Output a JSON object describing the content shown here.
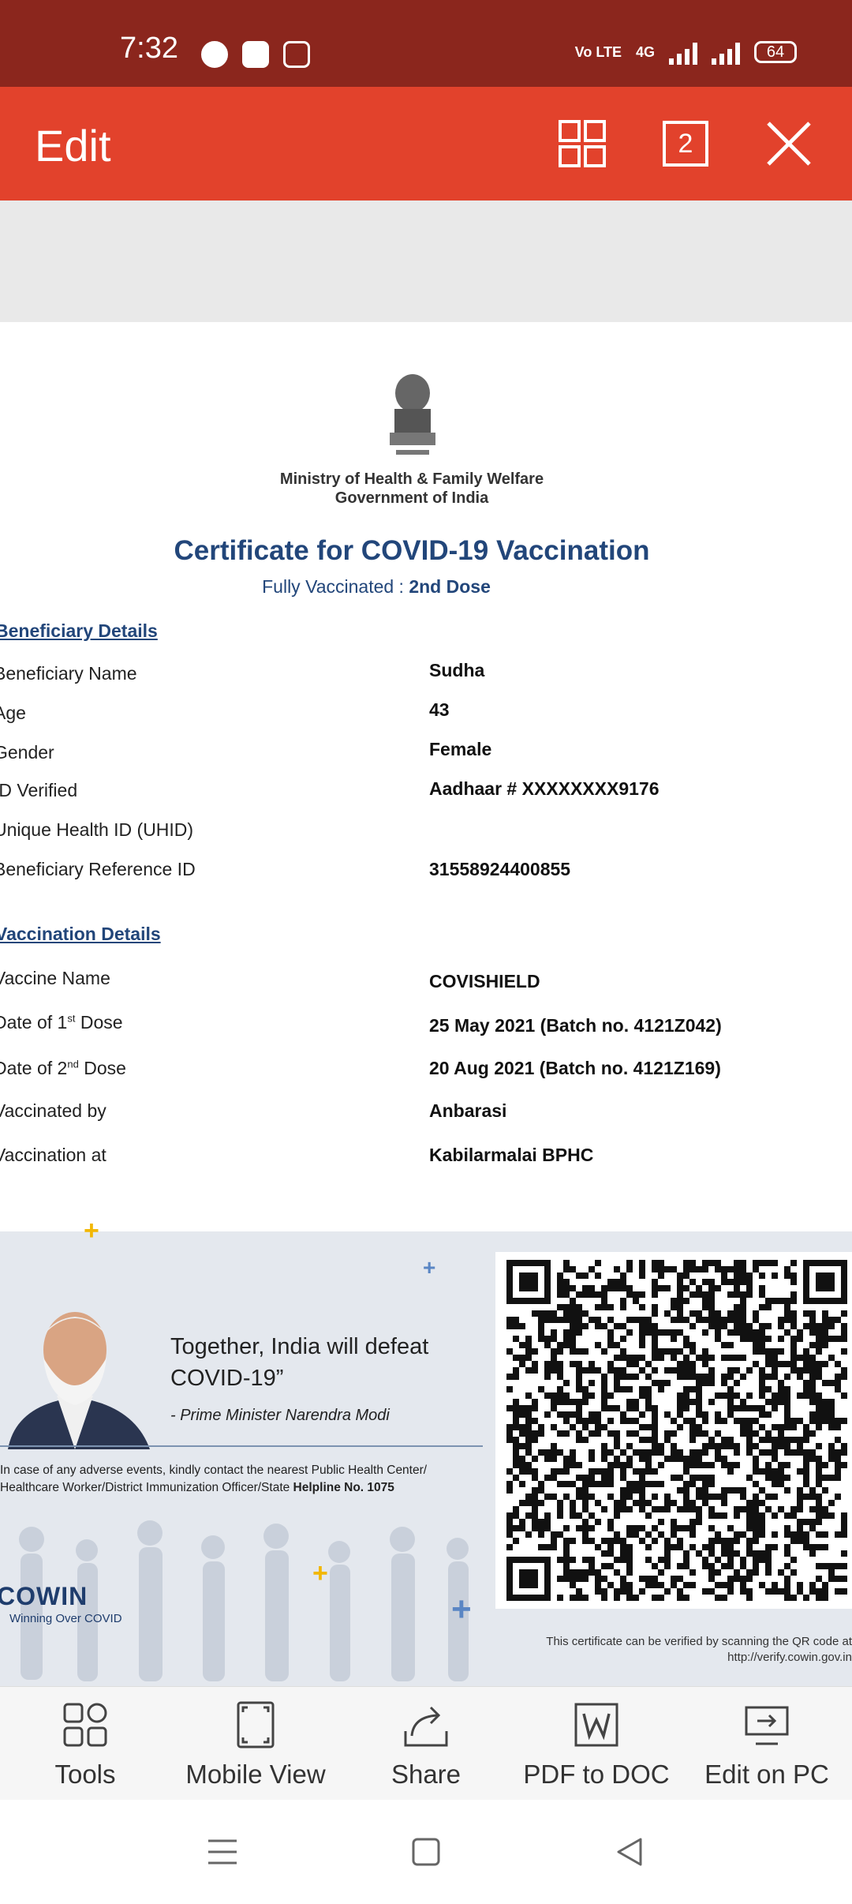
{
  "status_bar": {
    "time": "7:32",
    "network_label": "Vo LTE",
    "network_type": "4G",
    "battery": "64"
  },
  "header": {
    "title": "Edit",
    "page_count": "2"
  },
  "certificate": {
    "ministry_line1": "Ministry of Health & Family Welfare",
    "ministry_line2": "Government of India",
    "title": "Certificate for COVID-19 Vaccination",
    "subtitle_prefix": "Fully Vaccinated : ",
    "subtitle_dose": "2nd Dose",
    "beneficiary_heading": "Beneficiary Details",
    "beneficiary": {
      "name_label": "Beneficiary Name",
      "name": "Sudha",
      "age_label": "Age",
      "age": "43",
      "gender_label": "Gender",
      "gender": "Female",
      "id_label": "ID Verified",
      "id_value": "Aadhaar # XXXXXXXX9176",
      "uhid_label": "Unique Health ID (UHID)",
      "ref_label": "Beneficiary Reference ID",
      "ref_value": "31558924400855"
    },
    "vaccination_heading": "Vaccination Details",
    "vaccination": {
      "vaccine_label": "Vaccine Name",
      "vaccine": "COVISHIELD",
      "dose1_label_pre": "Date of 1",
      "dose1_sup": "st",
      "dose1_label_post": " Dose",
      "dose1": "25 May 2021 (Batch no. 4121Z042)",
      "dose2_label_pre": "Date of 2",
      "dose2_sup": "nd",
      "dose2_label_post": " Dose",
      "dose2": "20 Aug 2021 (Batch no. 4121Z169)",
      "by_label": "Vaccinated by",
      "by": "Anbarasi",
      "at_label": "Vaccination at",
      "at": "Kabilarmalai BPHC"
    },
    "quote": "Together, India will defeat COVID-19”",
    "quote_by": "- Prime Minister Narendra Modi",
    "adverse_line1": "In case of any adverse events, kindly contact the nearest Public Health Center/",
    "adverse_line2_pre": "Healthcare Worker/District Immunization Officer/State ",
    "adverse_helpline": "Helpline No. 1075",
    "cowin_logo": "COWIN",
    "cowin_tagline": "Winning Over COVID",
    "verify_line1": "This certificate can be verified by scanning the QR code at",
    "verify_line2": "http://verify.cowin.gov.in"
  },
  "toolbar": {
    "items": [
      {
        "label": "Tools",
        "icon": "tools-grid-icon"
      },
      {
        "label": "Mobile View",
        "icon": "mobile-view-icon"
      },
      {
        "label": "Share",
        "icon": "share-icon"
      },
      {
        "label": "PDF to DOC",
        "icon": "word-doc-icon"
      },
      {
        "label": "Edit on PC",
        "icon": "desktop-icon"
      }
    ]
  },
  "colors": {
    "status_bar": "#8b261d",
    "header": "#e2422c",
    "cert_blue": "#22467a"
  }
}
